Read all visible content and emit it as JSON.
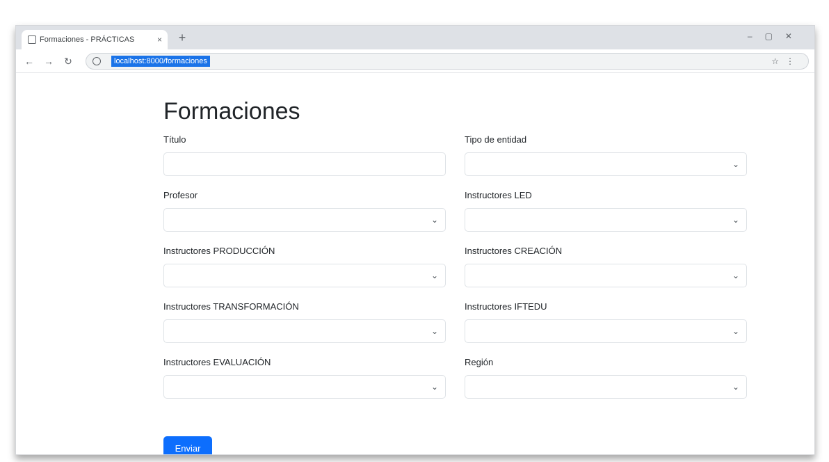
{
  "browser": {
    "tab_title": "Formaciones - PRÁCTICAS",
    "url": "localhost:8000/formaciones",
    "new_tab": "+",
    "tab_close": "×"
  },
  "page": {
    "title": "Formaciones"
  },
  "form": {
    "fields": [
      {
        "label": "Título",
        "type": "text",
        "value": ""
      },
      {
        "label": "Tipo de entidad",
        "type": "select",
        "value": ""
      },
      {
        "label": "Profesor",
        "type": "select",
        "value": ""
      },
      {
        "label": "Instructores LED",
        "type": "select",
        "value": ""
      },
      {
        "label": "Instructores PRODUCCIÓN",
        "type": "select",
        "value": ""
      },
      {
        "label": "Instructores CREACIÓN",
        "type": "select",
        "value": ""
      },
      {
        "label": "Instructores TRANSFORMACIÓN",
        "type": "select",
        "value": ""
      },
      {
        "label": "Instructores IFTEDU",
        "type": "select",
        "value": ""
      },
      {
        "label": "Instructores EVALUACIÓN",
        "type": "select",
        "value": ""
      },
      {
        "label": "Región",
        "type": "select",
        "value": ""
      }
    ],
    "submit_label": "Enviar"
  },
  "colors": {
    "primary": "#0d6efd",
    "url_highlight": "#1a73e8",
    "tabstrip": "#dee1e6"
  }
}
